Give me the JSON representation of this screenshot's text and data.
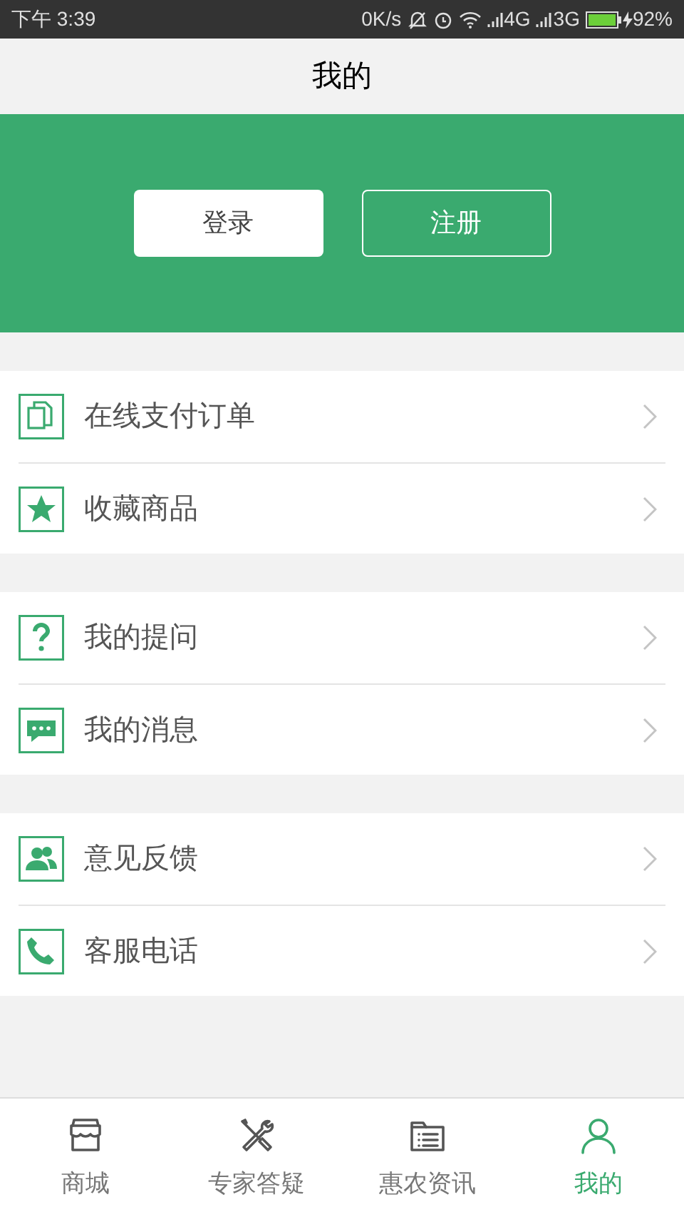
{
  "status_bar": {
    "time": "下午 3:39",
    "speed": "0K/s",
    "network_1": "4G",
    "network_2": "3G",
    "battery": "92%"
  },
  "header": {
    "title": "我的"
  },
  "account": {
    "buttons": [
      {
        "label": "登录",
        "kind": "filled"
      },
      {
        "label": "注册",
        "kind": "outline"
      }
    ]
  },
  "menu_groups": [
    {
      "items": [
        {
          "label": "在线支付订单",
          "kind": "documents"
        },
        {
          "label": "收藏商品",
          "kind": "star"
        }
      ]
    },
    {
      "items": [
        {
          "label": "我的提问",
          "kind": "question"
        },
        {
          "label": "我的消息",
          "kind": "chat"
        }
      ]
    },
    {
      "items": [
        {
          "label": "意见反馈",
          "kind": "people"
        },
        {
          "label": "客服电话",
          "kind": "phone"
        }
      ]
    }
  ],
  "tab_bar": [
    {
      "label": "商城",
      "kind": "store",
      "selected": false
    },
    {
      "label": "专家答疑",
      "kind": "tools",
      "selected": false
    },
    {
      "label": "惠农资讯",
      "kind": "news",
      "selected": false
    },
    {
      "label": "我的",
      "kind": "person",
      "selected": true
    }
  ]
}
